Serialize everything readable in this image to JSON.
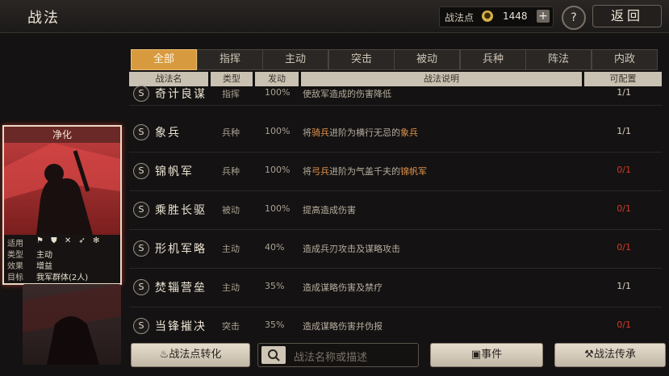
{
  "header": {
    "title": "战法",
    "points_label": "战法点",
    "points_value": "1448",
    "plus_label": "+",
    "help_label": "?",
    "back_label": "返回"
  },
  "tabs": [
    "全部",
    "指挥",
    "主动",
    "突击",
    "被动",
    "兵种",
    "阵法",
    "内政"
  ],
  "columns": {
    "name": "战法名",
    "type": "类型",
    "rate": "发动",
    "desc": "战法说明",
    "config": "可配置"
  },
  "rows": [
    {
      "badge": "S",
      "name": "奇计良谋",
      "type": "指挥",
      "rate": "100%",
      "desc": "使敌军造成的伤害降低",
      "config": "1/1"
    },
    {
      "badge": "S",
      "name": "象兵",
      "type": "兵种",
      "rate": "100%",
      "desc_pre": "将",
      "desc_hl1": "骑兵",
      "desc_mid": "进阶为横行无忌的",
      "desc_hl2": "象兵",
      "config": "1/1"
    },
    {
      "badge": "S",
      "name": "锦帆军",
      "type": "兵种",
      "rate": "100%",
      "desc_pre": "将",
      "desc_hl1": "弓兵",
      "desc_mid": "进阶为气盖千夫的",
      "desc_hl2": "锦帆军",
      "config": "0/1"
    },
    {
      "badge": "S",
      "name": "乘胜长驱",
      "type": "被动",
      "rate": "100%",
      "desc": "提高造成伤害",
      "config": "0/1"
    },
    {
      "badge": "S",
      "name": "形机军略",
      "type": "主动",
      "rate": "40%",
      "desc": "造成兵刃攻击及谋略攻击",
      "config": "0/1"
    },
    {
      "badge": "S",
      "name": "焚辎营垒",
      "type": "主动",
      "rate": "35%",
      "desc": "造成谋略伤害及禁疗",
      "config": "1/1"
    },
    {
      "badge": "S",
      "name": "当锋摧决",
      "type": "突击",
      "rate": "35%",
      "desc": "造成谋略伤害并伪报",
      "config": "0/1"
    }
  ],
  "card": {
    "title": "净化",
    "k1": "适用",
    "k2": "类型",
    "v2": "主动",
    "k3": "效果",
    "v3": "增益",
    "k4": "目标",
    "v4": "我军群体(2人)"
  },
  "buttons": {
    "convert": "战法点转化",
    "event": "事件",
    "inherit": "战法传承"
  },
  "search": {
    "placeholder": "战法名称或描述"
  },
  "colors": {
    "accent": "#d89a3e",
    "highlight": "#e0924a",
    "unavailable": "#d23b2b"
  }
}
